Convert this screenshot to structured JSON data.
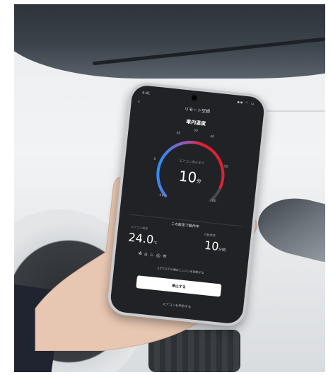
{
  "status": {
    "time": "9:41",
    "icons": "▪▪ ◠ ▭"
  },
  "header": {
    "back": "‹",
    "title": "リモート空調"
  },
  "section": {
    "title": "車内温度"
  },
  "gauge": {
    "ticks": [
      "20",
      "30",
      "40",
      "50",
      "60",
      "-20",
      "0"
    ],
    "sub_label": "エアコン停止まで",
    "value": "10",
    "unit": "分",
    "level_fraction": 0.7,
    "colors": {
      "cold": "#2f8cff",
      "hot": "#e1202f",
      "track": "#4a4b50"
    }
  },
  "settings": {
    "title": "この設定で動作中",
    "temp_label": "エアコン設定",
    "temp_value": "24.0",
    "temp_unit": "℃",
    "time_label": "作動時間",
    "time_value": "10",
    "time_unit": "分間",
    "icons": [
      "fan-icon",
      "defroster-icon",
      "seat-heater-icon",
      "steering-heater-icon",
      "rear-defogger-icon"
    ],
    "note": "-10℃以下の場合エンジンを始動する"
  },
  "actions": {
    "stop": "停止する",
    "link": "エアコンを予約する"
  }
}
